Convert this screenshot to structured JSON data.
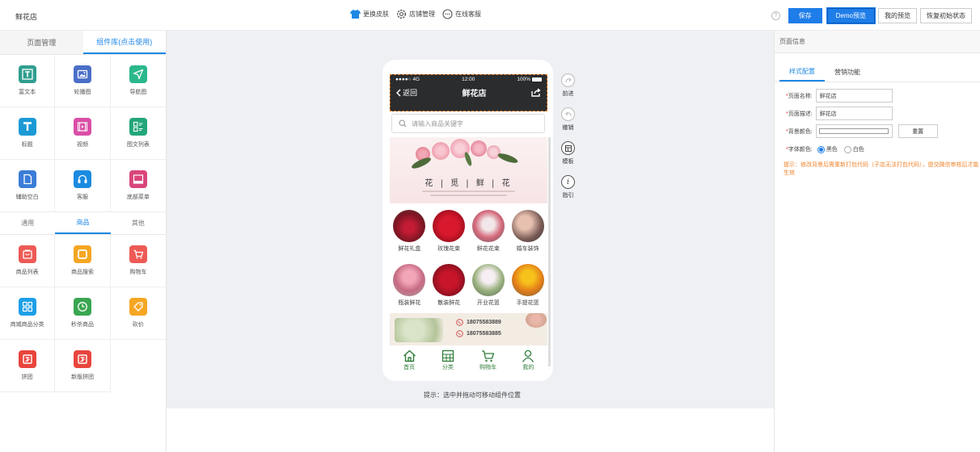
{
  "shop_name": "鲜花店",
  "top_center": [
    {
      "icon": "tshirt-icon",
      "label": "更换皮肤"
    },
    {
      "icon": "gear-icon",
      "label": "店铺管理"
    },
    {
      "icon": "chat-icon",
      "label": "在线客服"
    }
  ],
  "top_right": {
    "help": "?",
    "save": "保存",
    "demo": "Demo预览",
    "my_preview": "我的预览",
    "restore": "恢复初始状态"
  },
  "left_tabs": [
    "页面管理",
    "组件库(点击使用)"
  ],
  "components": [
    {
      "label": "富文本",
      "icon": "richtext-icon",
      "color": "#2f9e8f"
    },
    {
      "label": "轮播图",
      "icon": "carousel-icon",
      "color": "#4a6fc7"
    },
    {
      "label": "导航图",
      "icon": "navigation-icon",
      "color": "#2bb78c"
    },
    {
      "label": "标题",
      "icon": "title-icon",
      "color": "#1c9ad6"
    },
    {
      "label": "视频",
      "icon": "video-icon",
      "color": "#d94fa6"
    },
    {
      "label": "图文列表",
      "icon": "list-icon",
      "color": "#23a67a"
    },
    {
      "label": "辅助空白",
      "icon": "blank-icon",
      "color": "#3b7dd8"
    },
    {
      "label": "客服",
      "icon": "headset-icon",
      "color": "#1b8be0"
    },
    {
      "label": "底部菜单",
      "icon": "bottom-menu-icon",
      "color": "#d9457a"
    }
  ],
  "sub_tabs": [
    "通用",
    "商品",
    "其他"
  ],
  "goods": [
    {
      "label": "商品列表",
      "icon": "goods-list-icon",
      "color": "#ee5a55"
    },
    {
      "label": "商品搜索",
      "icon": "goods-search-icon",
      "color": "#f5a623"
    },
    {
      "label": "购物车",
      "icon": "cart-icon",
      "color": "#ee5a55"
    },
    {
      "label": "商城商品分类",
      "icon": "category-icon",
      "color": "#1d9fe6"
    },
    {
      "label": "秒杀商品",
      "icon": "clock-icon",
      "color": "#3aa651"
    },
    {
      "label": "砍价",
      "icon": "bargain-icon",
      "color": "#f5a623"
    },
    {
      "label": "拼团",
      "icon": "group-buy-icon",
      "color": "#e8453c"
    },
    {
      "label": "新版拼团",
      "icon": "new-group-buy-icon",
      "color": "#e8453c"
    }
  ],
  "phone": {
    "status_signal": "●●●●○ 4G",
    "status_time": "12:00",
    "status_battery": "100%",
    "back": "返回",
    "title": "鲜花店",
    "search_placeholder": "请输入商品关键字",
    "banner_title": "花 | 觅 | 鲜 | 花",
    "categories_row1": [
      "鲜花礼盒",
      "玫瑰花束",
      "鲜花花束",
      "婚车装饰"
    ],
    "categories_row2": [
      "瓶装鲜花",
      "散装鲜花",
      "开业花篮",
      "手提花篮"
    ],
    "phone1": "18075583889",
    "phone2": "18075583885",
    "tabbar": [
      {
        "label": "首页",
        "icon": "home-icon"
      },
      {
        "label": "分类",
        "icon": "grid-icon"
      },
      {
        "label": "购物车",
        "icon": "cart-icon"
      },
      {
        "label": "我的",
        "icon": "user-icon"
      }
    ]
  },
  "side_tools": [
    {
      "label": "前进",
      "icon": "forward-icon"
    },
    {
      "label": "撤销",
      "icon": "undo-icon"
    },
    {
      "label": "模板",
      "icon": "template-icon"
    },
    {
      "label": "指引",
      "icon": "info-icon"
    }
  ],
  "hint": "提示：选中并拖动可移动组件位置",
  "right_panel": {
    "title": "页面信息",
    "tabs": [
      "样式配置",
      "营销功能"
    ],
    "page_name_label": "页面名称:",
    "page_name_value": "鲜花店",
    "page_desc_label": "页面描述:",
    "page_desc_value": "鲜花店",
    "bg_color_label": "背景颜色:",
    "reset": "重置",
    "font_color_label": "字体颜色:",
    "font_color_options": [
      "黑色",
      "白色"
    ],
    "warning": "提示：修改背景后需重新打包代码（子店无法打包代码），提交微信审核后才能生效"
  },
  "colors": {
    "accent": "#1e88e5",
    "header_bg": "#2a2c2e",
    "tab_green": "#2f7d3a",
    "warning": "#f0842d"
  }
}
